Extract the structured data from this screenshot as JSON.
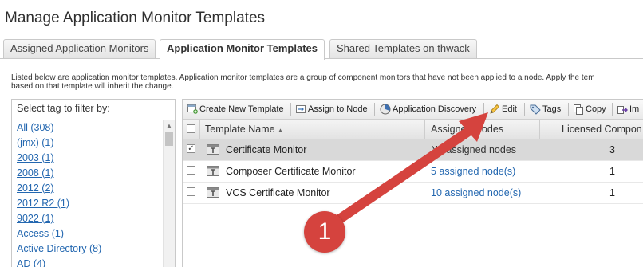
{
  "page": {
    "title": "Manage Application Monitor Templates"
  },
  "tabs": [
    {
      "label": "Assigned Application Monitors",
      "active": false
    },
    {
      "label": "Application Monitor Templates",
      "active": true
    },
    {
      "label": "Shared Templates on thwack",
      "active": false
    }
  ],
  "description": {
    "line1": "Listed below are application monitor templates. Application monitor templates are a group of component monitors that have not been applied to a node. Apply the tem",
    "line2": "based on that template will inherit the change."
  },
  "tag_filter": {
    "header": "Select tag to filter by:",
    "tags": [
      "All (308)",
      "(jmx) (1)",
      "2003 (1)",
      "2008 (1)",
      "2012 (2)",
      "2012 R2 (1)",
      "9022 (1)",
      "Access (1)",
      "Active Directory (8)",
      "AD (4)"
    ]
  },
  "toolbar": {
    "create": "Create New Template",
    "assign": "Assign to Node",
    "discovery": "Application Discovery",
    "edit": "Edit",
    "tags": "Tags",
    "copy": "Copy",
    "import": "Im"
  },
  "grid": {
    "columns": {
      "name": "Template Name",
      "nodes": "Assigned Nodes",
      "licensed": "Licensed Compon"
    },
    "rows": [
      {
        "checked": true,
        "name": "Certificate Monitor",
        "nodes": "No assigned nodes",
        "licensed": "3"
      },
      {
        "checked": false,
        "name": "Composer Certificate Monitor",
        "nodes": "5 assigned node(s)",
        "licensed": "1"
      },
      {
        "checked": false,
        "name": "VCS Certificate Monitor",
        "nodes": "10 assigned node(s)",
        "licensed": "1"
      }
    ]
  },
  "annotation": {
    "badge": "1"
  },
  "colors": {
    "link": "#2367b0",
    "annotation": "#d5433e",
    "selected_row": "#d9d9d9"
  },
  "icons": [
    "template-icon",
    "pencil-icon",
    "tag-icon",
    "copy-icon",
    "import-icon",
    "discovery-icon",
    "assign-icon",
    "create-template-icon"
  ]
}
